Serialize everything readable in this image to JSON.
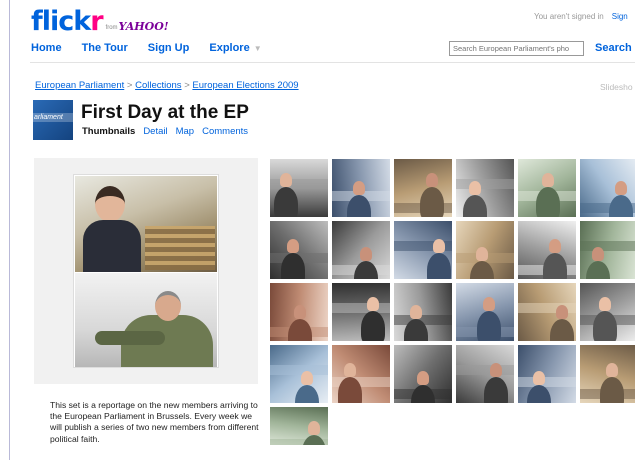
{
  "header": {
    "logo": {
      "part1": "flick",
      "part2": "r",
      "from": "from",
      "partner": "YAHOO!"
    },
    "signin_text": "You aren't signed in",
    "signin_link": "Sign",
    "nav": [
      {
        "label": "Home"
      },
      {
        "label": "The Tour"
      },
      {
        "label": "Sign Up"
      },
      {
        "label": "Explore",
        "has_dropdown": true
      }
    ],
    "search": {
      "placeholder": "Search European Parliament's pho",
      "button": "Search"
    }
  },
  "breadcrumb": [
    {
      "label": "European Parliament"
    },
    {
      "label": "Collections"
    },
    {
      "label": "European Elections 2009"
    }
  ],
  "breadcrumb_sep": ">",
  "slideshow": "Slidesho",
  "set": {
    "thumb_text": "arliament",
    "title": "First Day at the EP",
    "tabs": [
      {
        "label": "Thumbnails",
        "active": true
      },
      {
        "label": "Detail",
        "active": false
      },
      {
        "label": "Map",
        "active": false
      },
      {
        "label": "Comments",
        "active": false
      }
    ],
    "description": "This set is a reportage on the new members arriving to the European Parliament in Brussels. Every week we will publish a series of two new members from different political faith."
  },
  "colors": {
    "flickr_blue": "#0063dc",
    "flickr_pink": "#ff0084",
    "yahoo_purple": "#7b0099",
    "panel_bg": "#f1f1f1"
  }
}
